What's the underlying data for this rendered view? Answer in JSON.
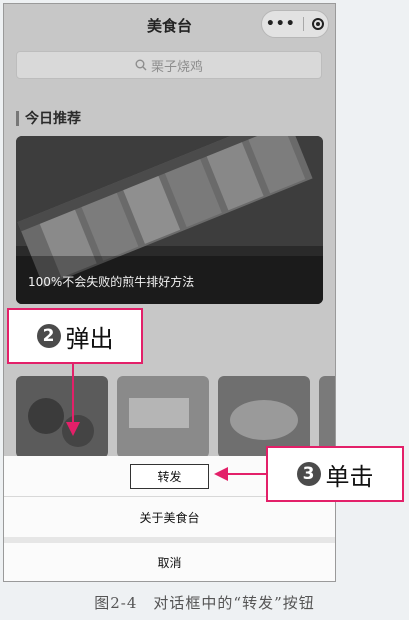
{
  "app": {
    "title": "美食台",
    "more_icon": "more-dots-icon",
    "close_icon": "target-circle-icon"
  },
  "search": {
    "placeholder": "栗子烧鸡"
  },
  "section": {
    "title": "今日推荐"
  },
  "hero": {
    "caption": "100%不会失败的煎牛排好方法"
  },
  "sheet": {
    "forward": "转发",
    "about": "关于美食台",
    "cancel": "取消"
  },
  "callouts": {
    "popup": {
      "number": "2",
      "text": "弹出"
    },
    "click": {
      "number": "3",
      "text": "单击"
    }
  },
  "figure_caption": "图2-4　对话框中的“转发”按钮",
  "colors": {
    "callout_border": "#e32069",
    "overlay": "#c7c7c7"
  }
}
